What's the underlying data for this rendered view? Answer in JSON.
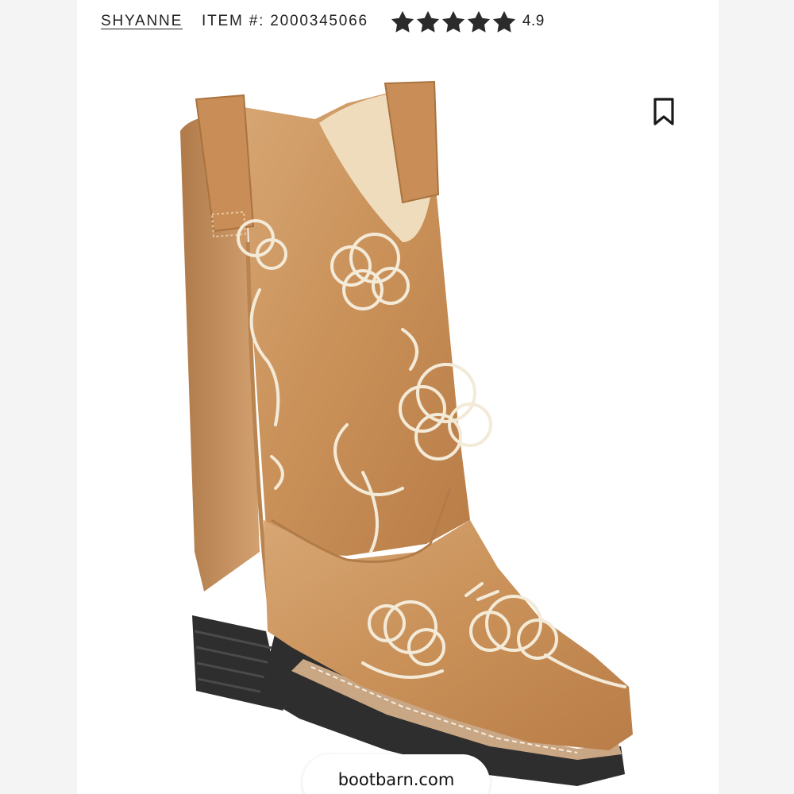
{
  "product": {
    "brand": "SHYANNE",
    "item_number": "ITEM #: 2000345066",
    "rating_value": "4.9",
    "rating_stars": 5,
    "image_icon": "cowboy-boot-image"
  },
  "actions": {
    "bookmark_icon": "bookmark-icon"
  },
  "watermark": {
    "domain": "bootbarn.com"
  },
  "colors": {
    "star": "#2b2b2b",
    "text": "#222222",
    "boot_leather": "#c9935a",
    "embroidery": "#f3ead8",
    "sole": "#2e2e2e"
  }
}
